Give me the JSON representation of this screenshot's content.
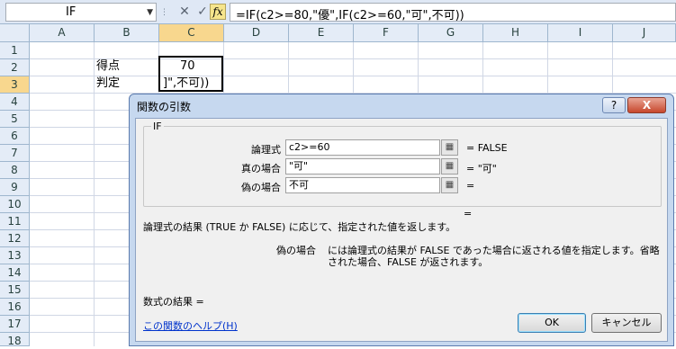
{
  "formula_bar": {
    "name_box": "IF",
    "formula": "=IF(c2>=80,\"優\",IF(c2>=60,\"可\",不可))",
    "icons": [
      "chevron-down-icon",
      "cancel-x-icon",
      "enter-check-icon",
      "fx-icon"
    ],
    "fx_label": "fx"
  },
  "sheet": {
    "columns": [
      "A",
      "B",
      "C",
      "D",
      "E",
      "F",
      "G",
      "H",
      "I",
      "J"
    ],
    "active_column": "C",
    "rows": [
      "1",
      "2",
      "3",
      "4",
      "5",
      "6",
      "7",
      "8",
      "9",
      "10",
      "11",
      "12",
      "13",
      "14",
      "15",
      "16",
      "17",
      "18",
      "19"
    ],
    "active_row": "3",
    "cells": {
      "B2": "得点",
      "C2": "70",
      "B3": "判定",
      "C3": "]\",不可))"
    }
  },
  "dialog": {
    "title": "関数の引数",
    "help_button": "?",
    "close_button": "X",
    "function_name": "IF",
    "arguments": [
      {
        "label": "論理式",
        "value": "c2>=60",
        "result": "= FALSE"
      },
      {
        "label": "真の場合",
        "value": "\"可\"",
        "result": "= \"可\""
      },
      {
        "label": "偽の場合",
        "value": "不可",
        "result": "="
      }
    ],
    "overall_result": "=",
    "description": "論理式の結果 (TRUE か FALSE) に応じて、指定された値を返します。",
    "param_name": "偽の場合",
    "param_description_line1": "には論理式の結果が FALSE であった場合に返される値を指定します。省略",
    "param_description_line2": "された場合、FALSE が返されます。",
    "formula_result": "数式の結果 =",
    "help_link": "この関数のヘルプ(H)",
    "ok_button": "OK",
    "cancel_button": "キャンセル"
  }
}
